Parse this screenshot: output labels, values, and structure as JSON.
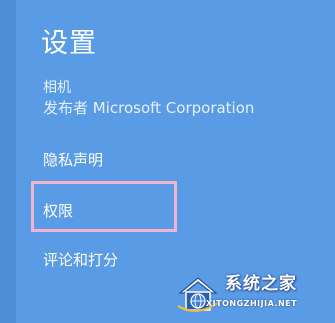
{
  "settings_panel": {
    "title": "设置",
    "app_name": "相机",
    "publisher": "发布者 Microsoft Corporation",
    "items": [
      {
        "label": "隐私声明"
      },
      {
        "label": "权限"
      },
      {
        "label": "评论和打分"
      }
    ],
    "highlighted_item": "权限"
  },
  "watermark": {
    "logo_icon": "house-globe-logo-icon",
    "brand_text": "系统之家",
    "url_text": "XITONGZHIJIA.NET"
  },
  "colors": {
    "panel_background": "#5a9be6",
    "highlight_border": "#f2b3cf",
    "text": "#ffffff"
  }
}
